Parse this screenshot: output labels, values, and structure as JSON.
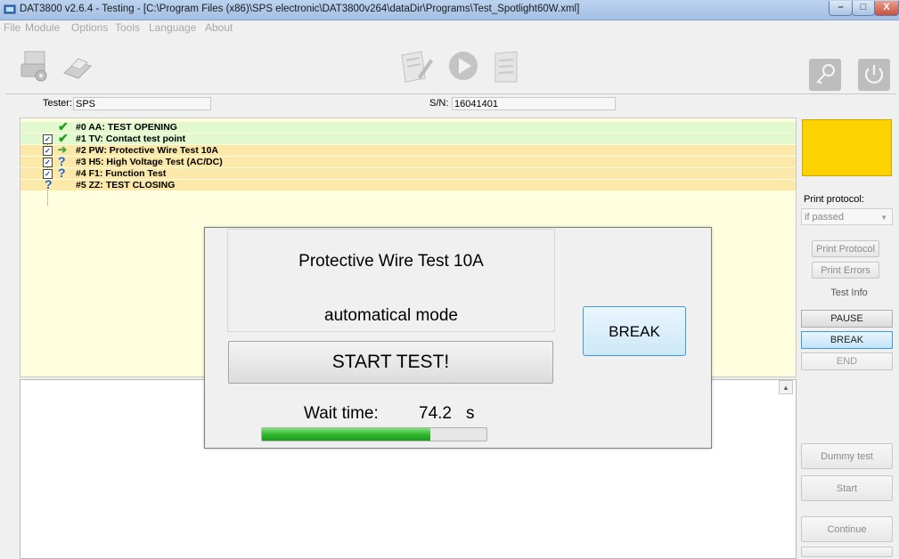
{
  "window": {
    "title": "DAT3800 v2.6.4 - Testing - [C:\\Program Files (x86)\\SPS electronic\\DAT3800v264\\dataDir\\Programs\\Test_Spotlight60W.xml]",
    "minimize": "–",
    "maximize": "□",
    "close": "X"
  },
  "menu": [
    "File",
    "Module",
    "Options",
    "Tools",
    "Language",
    "About"
  ],
  "toolbar": {
    "icons": [
      "printer-setup-icon",
      "printer-icon",
      "edit-icon",
      "play-icon",
      "document-icon",
      "key-icon",
      "power-icon"
    ]
  },
  "tester": {
    "label": "Tester:",
    "value": "SPS"
  },
  "serial": {
    "label": "S/N:",
    "value": "16041401"
  },
  "tests": [
    {
      "label": "#0 AA: TEST OPENING",
      "checkbox": false,
      "status": "passed",
      "row_color": "green"
    },
    {
      "label": "#1 TV: Contact test point",
      "checkbox": true,
      "status": "passed",
      "row_color": "green"
    },
    {
      "label": "#2 PW: Protective Wire Test 10A",
      "checkbox": true,
      "status": "current",
      "row_color": "yellow"
    },
    {
      "label": "#3 H5: High Voltage Test (AC/DC)",
      "checkbox": true,
      "status": "pending",
      "row_color": "yellow"
    },
    {
      "label": "#4 F1: Function Test",
      "checkbox": true,
      "status": "pending",
      "row_color": "yellow"
    },
    {
      "label": "#5 ZZ: TEST CLOSING",
      "checkbox": false,
      "status": "pending",
      "row_color": "yellow"
    }
  ],
  "status_glyphs": {
    "passed": "✔",
    "current": "➔",
    "pending": "?"
  },
  "checkbox_glyph": "✓",
  "sidebar": {
    "status_color": "#fcd200",
    "print_protocol_label": "Print protocol:",
    "print_protocol_value": "if passed",
    "print_protocol_arrow": "▼",
    "print_protocol_button": "Print Protocol",
    "print_errors_button": "Print Errors",
    "test_info_button": "Test Info",
    "pause_button": "PAUSE",
    "break_button": "BREAK",
    "end_button": "END",
    "dummy_test_button": "Dummy test",
    "start_button": "Start",
    "continue_button": "Continue"
  },
  "log": {
    "scroll_up": "▲"
  },
  "dialog": {
    "title": "Protective Wire Test 10A",
    "mode": "automatical mode",
    "break_button": "BREAK",
    "start_button": "START TEST!",
    "wait_label": "Wait time:",
    "wait_value": "74.2",
    "wait_unit": "s",
    "progress_percent": 75
  },
  "colors": {
    "passed_row": "#e2f8cf",
    "pending_row": "#fce8a8",
    "list_background": "#ffffe0",
    "progress_green": "#2db32a",
    "check_green": "#1f9e1d",
    "question_blue": "#1e63d6"
  }
}
